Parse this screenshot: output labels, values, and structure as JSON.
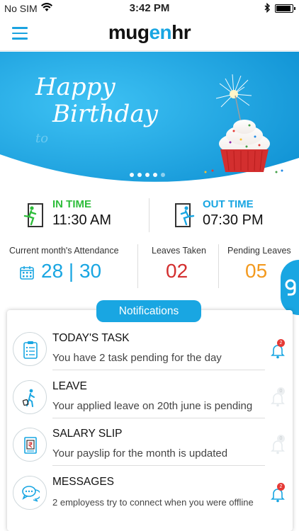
{
  "status_bar": {
    "carrier": "No SIM",
    "time": "3:42 PM",
    "battery_level": 0.95
  },
  "app": {
    "logo_part1": "mug",
    "logo_part2": "en",
    "logo_part3": "hr",
    "brand_color": "#19a6e2"
  },
  "banner": {
    "line1": "Happy",
    "line2": "Birthday",
    "line3": "to",
    "slide_count": 5,
    "active_slide": 5
  },
  "attendance_times": {
    "in_label": "IN TIME",
    "in_value": "11:30 AM",
    "in_color": "#2ebd3b",
    "out_label": "OUT TIME",
    "out_value": "07:30 PM",
    "out_color": "#19a6e2"
  },
  "stats": {
    "attendance_label": "Current month's Attendance",
    "attendance_value": "28 | 30",
    "attendance_color": "#19a6e2",
    "leaves_taken_label": "Leaves Taken",
    "leaves_taken_value": "02",
    "leaves_taken_color": "#d32f2f",
    "pending_leaves_label": "Pending Leaves",
    "pending_leaves_value": "05",
    "pending_leaves_color": "#f39a1f"
  },
  "notifications": {
    "title": "Notifications",
    "items": [
      {
        "title": "TODAY'S TASK",
        "description": "You have 2 task pending for the day",
        "badge": "2",
        "icon": "clipboard-icon",
        "active": true
      },
      {
        "title": "LEAVE",
        "description": "Your applied leave on 20th june is pending",
        "badge": "0",
        "icon": "traveler-icon",
        "active": false
      },
      {
        "title": "SALARY SLIP",
        "description": "Your payslip for the month is updated",
        "badge": "0",
        "icon": "payslip-icon",
        "active": false
      },
      {
        "title": "MESSAGES",
        "description": "2 employess try to connect when you were offline",
        "badge": "2",
        "icon": "chat-icon",
        "active": true
      }
    ]
  }
}
